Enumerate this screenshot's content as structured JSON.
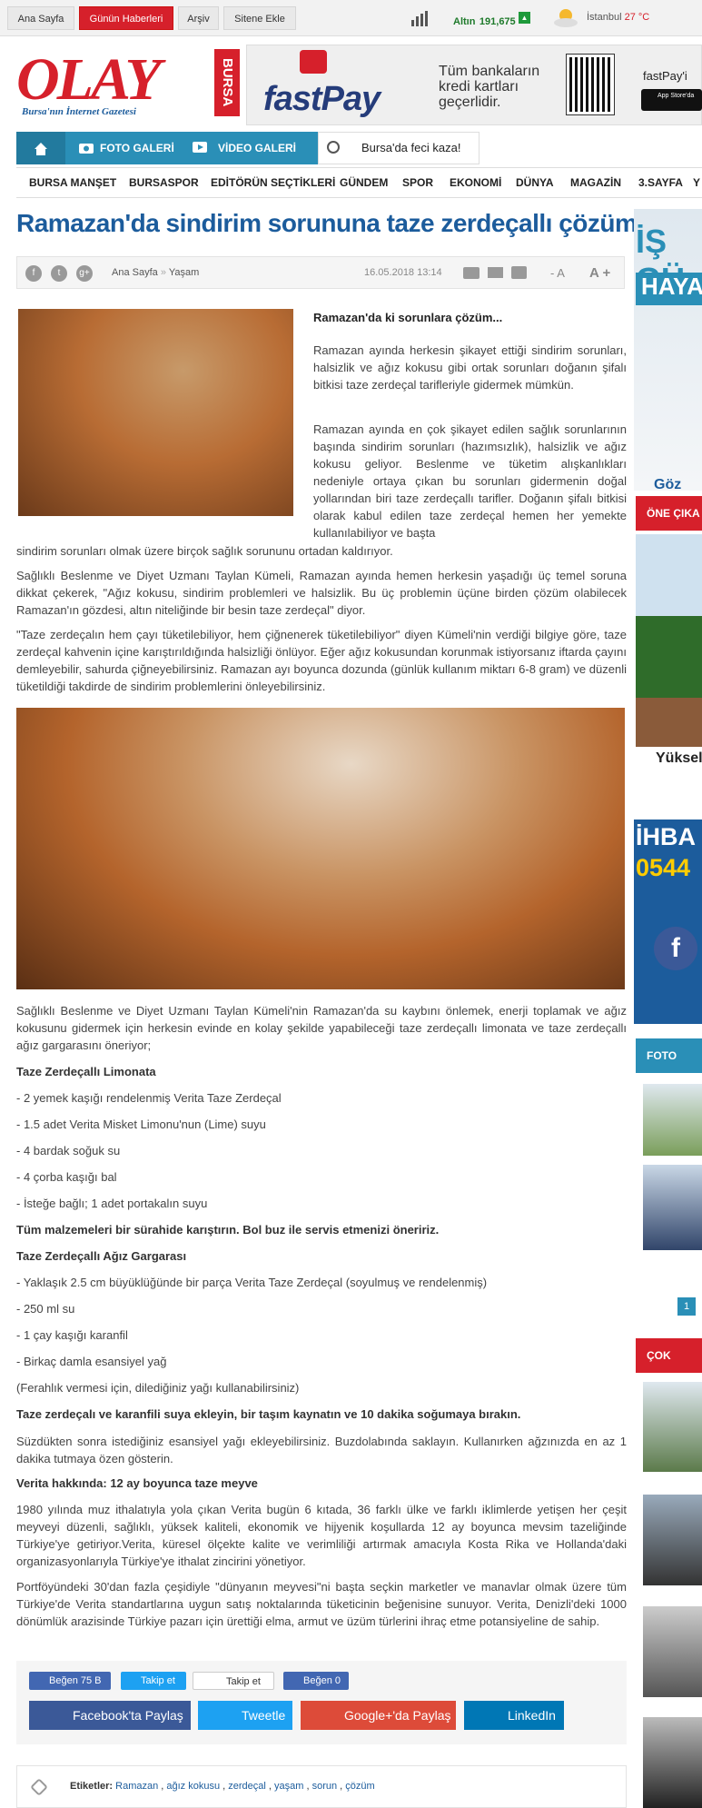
{
  "topbar": {
    "home": "Ana Sayfa",
    "news": "Günün Haberleri",
    "archive": "Arşiv",
    "add_site": "Sitene Ekle",
    "gold_label": "Altın",
    "gold_value": "191,675",
    "city": "İstanbul",
    "temp": "27 °C"
  },
  "logo": {
    "brand": "OLAY",
    "sub": "BURSA",
    "tagline": "Bursa'nın İnternet Gazetesi"
  },
  "ad": {
    "brand": "fastPay",
    "text1": "Tüm bankaların",
    "text2": "kredi kartları",
    "text3": "geçerlidir.",
    "side": "fastPay'i",
    "store": "App Store'da"
  },
  "navblue": {
    "photo": "FOTO GALERİ",
    "video": "VİDEO GALERİ",
    "breaking": "Bursa'da feci kaza!"
  },
  "menu": [
    "BURSA MANŞET",
    "BURSASPOR",
    "EDİTÖRÜN SEÇTİKLERİ",
    "GÜNDEM",
    "SPOR",
    "EKONOMİ",
    "DÜNYA",
    "MAGAZİN",
    "3.SAYFA",
    "Y"
  ],
  "article": {
    "title": "Ramazan'da sindirim sorununa taze zerdeçallı çözüm!",
    "breadcrumb_home": "Ana Sayfa",
    "breadcrumb_sep": "»",
    "breadcrumb_cat": "Yaşam",
    "date": "16.05.2018 13:14",
    "font_minus": "- A",
    "font_plus": "A +",
    "lead": "Ramazan'da ki sorunlara çözüm...",
    "p1": "Ramazan ayında herkesin şikayet ettiği sindirim sorunları, halsizlik ve ağız kokusu gibi ortak sorunları doğanın şifalı bitkisi taze zerdeçal tarifleriyle gidermek mümkün.",
    "p2a": "Ramazan ayında en çok şikayet edilen sağlık sorunlarının başında sindirim sorunları (hazımsızlık), halsizlik ve ağız kokusu geliyor. Beslenme ve tüketim alışkanlıkları nedeniyle ortaya çıkan bu sorunları gidermenin doğal yollarından biri taze zerdeçallı tarifler. Doğanın şifalı bitkisi olarak kabul edilen taze zerdeçal hemen her yemekte kullanılabiliyor ve başta",
    "p2b": "sindirim sorunları olmak üzere birçok sağlık sorununu ortadan kaldırıyor.",
    "p3": "Sağlıklı Beslenme ve Diyet Uzmanı Taylan Kümeli, Ramazan ayında hemen herkesin yaşadığı üç temel soruna dikkat çekerek, \"Ağız kokusu, sindirim problemleri ve halsizlik. Bu üç problemin üçüne birden çözüm olabilecek Ramazan'ın gözdesi, altın niteliğinde bir besin taze zerdeçal\" diyor.",
    "p4": "\"Taze zerdeçalın hem çayı tüketilebiliyor, hem çiğnenerek tüketilebiliyor\" diyen Kümeli'nin verdiği bilgiye göre, taze zerdeçal kahvenin içine karıştırıldığında halsizliği önlüyor. Eğer ağız kokusundan korunmak istiyorsanız iftarda çayını demleyebilir, sahurda çiğneyebilirsiniz. Ramazan ayı boyunca dozunda (günlük kullanım miktarı 6-8 gram) ve düzenli tüketildiği takdirde de sindirim problemlerini önleyebilirsiniz.",
    "p5": "Sağlıklı Beslenme ve Diyet Uzmanı Taylan Kümeli'nin Ramazan'da su kaybını önlemek, enerji toplamak ve ağız kokusunu gidermek için herkesin evinde en kolay şekilde yapabileceği taze zerdeçallı limonata ve taze zerdeçallı ağız gargarasını öneriyor;",
    "h1": "Taze Zerdeçallı Limonata",
    "l1": [
      "- 2 yemek kaşığı rendelenmiş Verita Taze Zerdeçal",
      "- 1.5 adet Verita Misket Limonu'nun (Lime) suyu",
      "- 4 bardak soğuk su",
      "- 4 çorba kaşığı bal",
      "- İsteğe bağlı; 1 adet portakalın suyu"
    ],
    "s1": "Tüm malzemeleri bir sürahide karıştırın. Bol buz ile servis etmenizi öneririz.",
    "h2": "Taze Zerdeçallı Ağız Gargarası",
    "l2": [
      "- Yaklaşık 2.5 cm büyüklüğünde bir parça Verita Taze Zerdeçal (soyulmuş ve rendelenmiş)",
      "- 250 ml su",
      "- 1 çay kaşığı karanfil",
      "- Birkaç damla esansiyel yağ",
      "(Ferahlık vermesi için, dilediğiniz yağı kullanabilirsiniz)"
    ],
    "s2": "Taze zerdeçalı ve karanfili suya ekleyin, bir taşım kaynatın ve 10 dakika soğumaya bırakın.",
    "p6": "Süzdükten sonra istediğiniz esansiyel yağı ekleyebilirsiniz. Buzdolabında saklayın. Kullanırken ağzınızda en az 1 dakika tutmaya özen gösterin.",
    "h3": "Verita hakkında: 12 ay boyunca taze meyve",
    "p7": "1980 yılında muz ithalatıyla yola çıkan Verita bugün 6 kıtada, 36 farklı ülke ve farklı iklimlerde yetişen her çeşit meyveyi düzenli, sağlıklı, yüksek kaliteli, ekonomik ve hijyenik koşullarda 12 ay boyunca mevsim tazeliğinde Türkiye'ye getiriyor.Verita, küresel ölçekte kalite ve verimliliği artırmak amacıyla Kosta Rika ve Hollanda'daki organizasyonlarıyla Türkiye'ye ithalat zincirini yönetiyor.",
    "p8": "Portföyündeki 30'dan fazla çeşidiyle \"dünyanın meyvesi\"ni başta seçkin marketler ve manavlar olmak üzere tüm Türkiye'de Verita standartlarına uygun satış noktalarında tüketicinin beğenisine sunuyor. Verita, Denizli'deki 1000 dönümlük arazisinde Türkiye pazarı için ürettiği elma, armut ve üzüm türlerini ihraç etme potansiyeline de sahip."
  },
  "social": {
    "like1": "Beğen 75 B",
    "follow_tw": "Takip et",
    "follow_g": "Takip et",
    "like2": "Beğen 0",
    "fb": "Facebook'ta Paylaş",
    "tw": "Tweetle",
    "gp": "Google+'da Paylaş",
    "li": "LinkedIn"
  },
  "tags": {
    "label": "Etiketler:",
    "items": [
      "Ramazan",
      "ağız kokusu",
      "zerdeçal",
      "yaşam",
      "sorun",
      "çözüm"
    ]
  },
  "sidebar": {
    "ad1a": "İŞ GÜ",
    "ad1b": "HAYAT",
    "ad1c": "Göz",
    "h_featured": "ÖNE ÇIKA",
    "featured_caption": "Yüksel",
    "ad2a": "İHBA",
    "ad2b": "0544",
    "h_photo": "FOTO GAL",
    "page": "1",
    "h_read": "ÇOK OKUN"
  },
  "colors": {
    "brand_red": "#d6202b",
    "accent_blue": "#2a8fb7",
    "title_blue": "#1c5c9c"
  }
}
